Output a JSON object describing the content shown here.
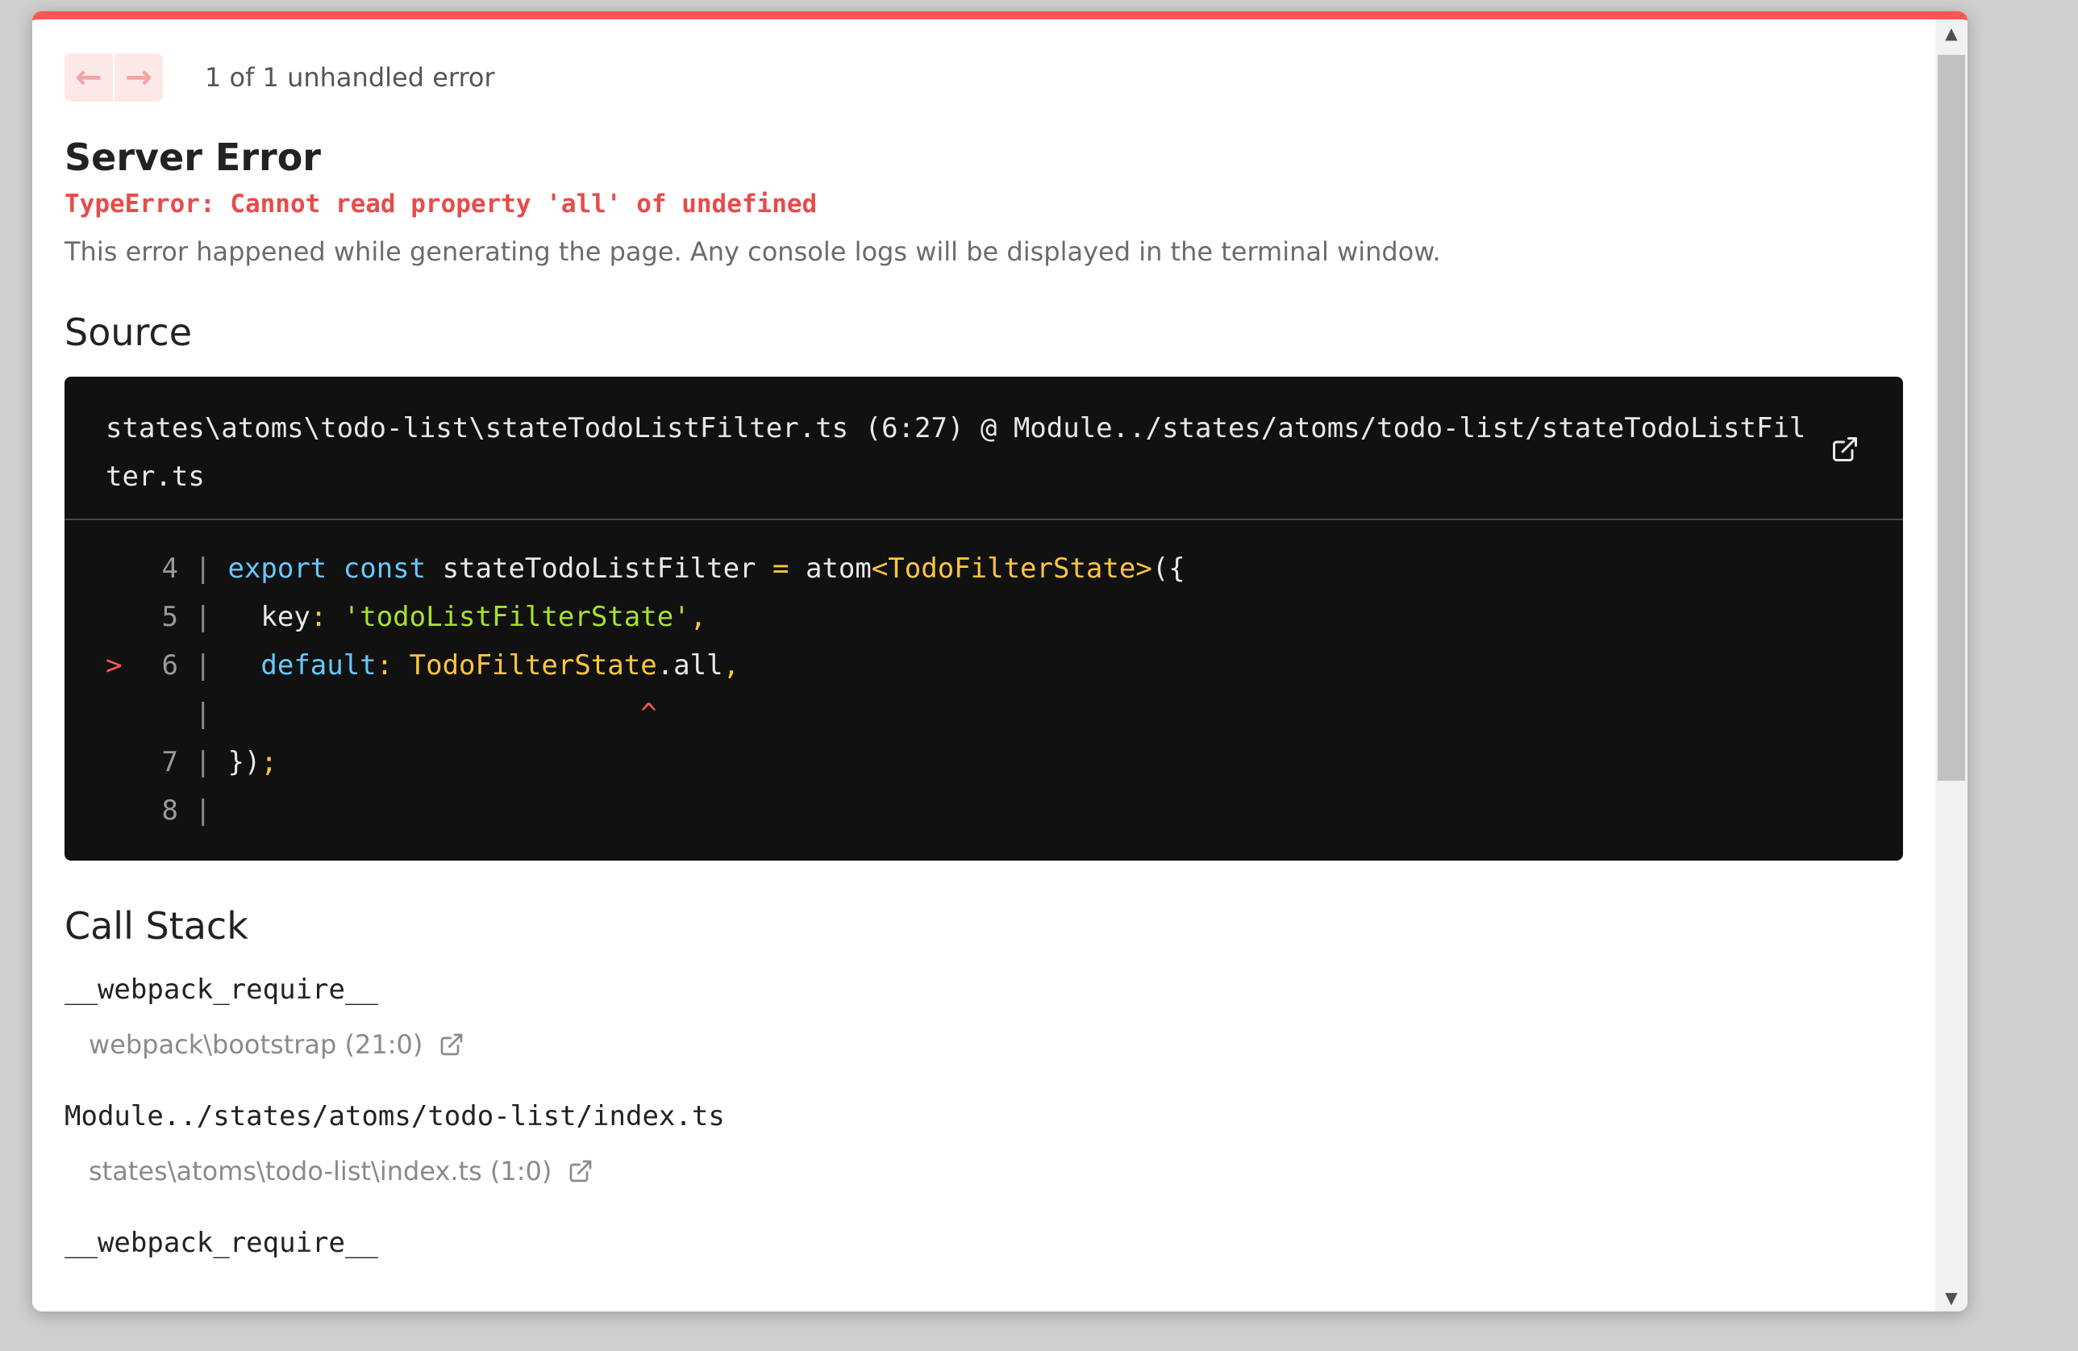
{
  "nav": {
    "prev_icon": "arrow-left-icon",
    "next_icon": "arrow-right-icon",
    "prev_glyph": "←",
    "next_glyph": "→",
    "counter_text": "1 of 1 unhandled error"
  },
  "error": {
    "title": "Server Error",
    "message": "TypeError: Cannot read property 'all' of undefined",
    "description": "This error happened while generating the page. Any console logs will be displayed in the terminal window."
  },
  "source": {
    "heading": "Source",
    "file_label": "states\\atoms\\todo-list\\stateTodoListFilter.ts (6:27) @ Module../states/atoms/todo-list/stateTodoListFilter.ts",
    "lines": [
      {
        "marker": "",
        "num": "4",
        "sep": "|",
        "t1": "export",
        "t2": " const",
        "t3": " stateTodoListFilter ",
        "t4": "=",
        "t5": " atom",
        "t6": "<TodoFilterState>",
        "t7": "({"
      },
      {
        "marker": "",
        "num": "5",
        "sep": "|",
        "t1": "  key",
        "t2": ":",
        "t3": " 'todoListFilterState'",
        "t4": ","
      },
      {
        "marker": ">",
        "num": "6",
        "sep": "|",
        "t1": "  default",
        "t2": ":",
        "t3": " TodoFilterState",
        "t4": ".all",
        "t5": ","
      },
      {
        "marker": "",
        "num": "",
        "sep": "|",
        "caret": "^"
      },
      {
        "marker": "",
        "num": "7",
        "sep": "|",
        "t1": " })",
        "t2": ";"
      },
      {
        "marker": "",
        "num": "8",
        "sep": "|"
      }
    ]
  },
  "call_stack": {
    "heading": "Call Stack",
    "frames": [
      {
        "fn": "__webpack_require__",
        "loc": "webpack\\bootstrap (21:0)"
      },
      {
        "fn": "Module../states/atoms/todo-list/index.ts",
        "loc": "states\\atoms\\todo-list\\index.ts (1:0)"
      },
      {
        "fn": "__webpack_require__"
      }
    ]
  },
  "colors": {
    "accent": "#ff5555",
    "code_bg": "#111111",
    "keyword": "#66c8ff",
    "string": "#a6e22e",
    "type": "#ffc53d"
  }
}
